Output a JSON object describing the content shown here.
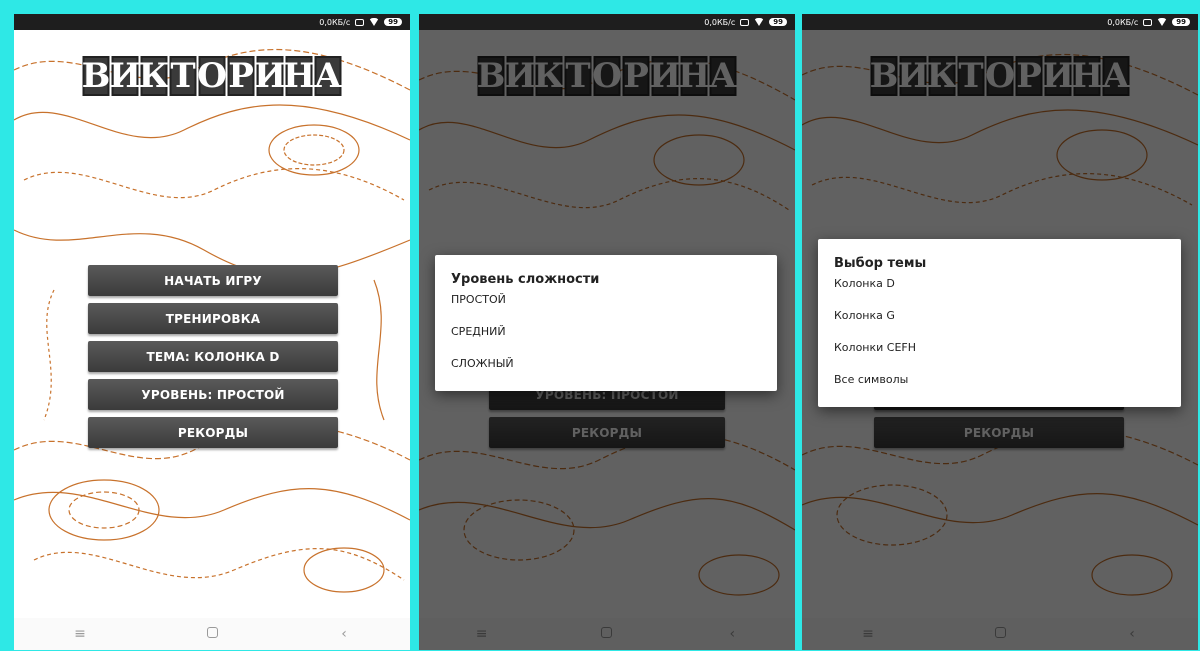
{
  "status": {
    "speed": "0,0КБ/с",
    "battery": "99"
  },
  "app_title": "ВИКТОРИНА",
  "menu": {
    "start": "НАЧАТЬ ИГРУ",
    "training": "ТРЕНИРОВКА",
    "topic": "ТЕМА: КОЛОНКА D",
    "level": "УРОВЕНЬ: ПРОСТОЙ",
    "records": "РЕКОРДЫ"
  },
  "difficulty_dialog": {
    "title": "Уровень сложности",
    "options": [
      "ПРОСТОЙ",
      "СРЕДНИЙ",
      "СЛОЖНЫЙ"
    ]
  },
  "topic_dialog": {
    "title": "Выбор темы",
    "options": [
      "Колонка D",
      "Колонка G",
      "Колонки CEFH",
      "Все символы"
    ]
  },
  "navbar": {
    "menu_glyph": "≡",
    "back_glyph": "‹"
  },
  "colors": {
    "frame": "#2ee8e6",
    "contour": "#c8722c",
    "button": "#4a4a4a",
    "scrim": "rgba(0,0,0,0.62)"
  }
}
